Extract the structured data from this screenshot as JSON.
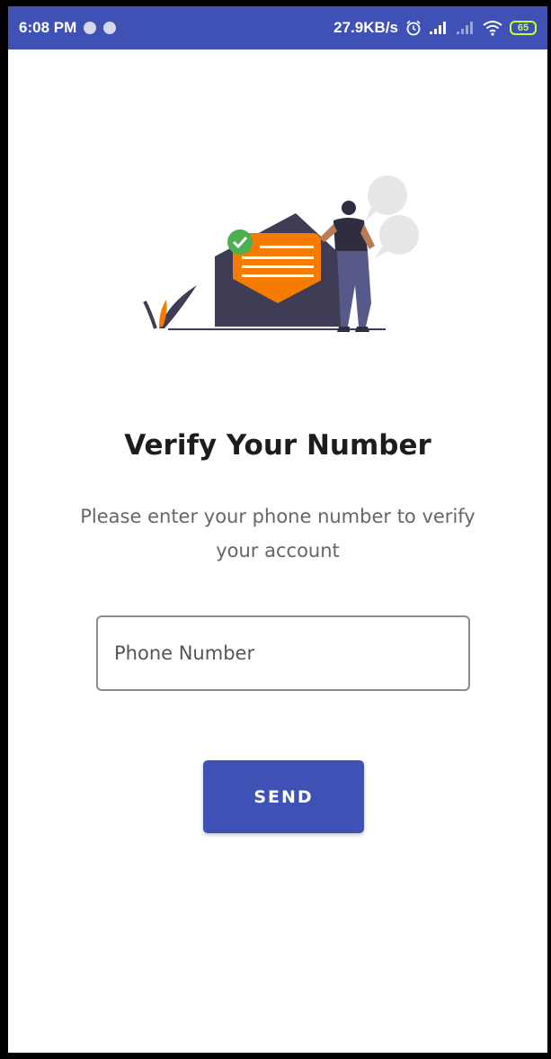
{
  "status_bar": {
    "time": "6:08 PM",
    "network_speed": "27.9KB/s",
    "battery_level": "65",
    "icons": [
      "notification-dot-icon",
      "notification-dot-icon",
      "alarm-icon",
      "signal-icon",
      "signal-weak-icon",
      "wifi-icon",
      "battery-icon"
    ]
  },
  "main": {
    "title": "Verify Your Number",
    "subtitle": "Please enter your phone number to verify your account",
    "phone_input": {
      "value": "",
      "placeholder": "Phone Number"
    },
    "send_label": "SEND"
  },
  "colors": {
    "primary": "#3f51b5",
    "accent": "#f57c00",
    "check": "#4caf50",
    "envelope": "#3f3d56"
  }
}
